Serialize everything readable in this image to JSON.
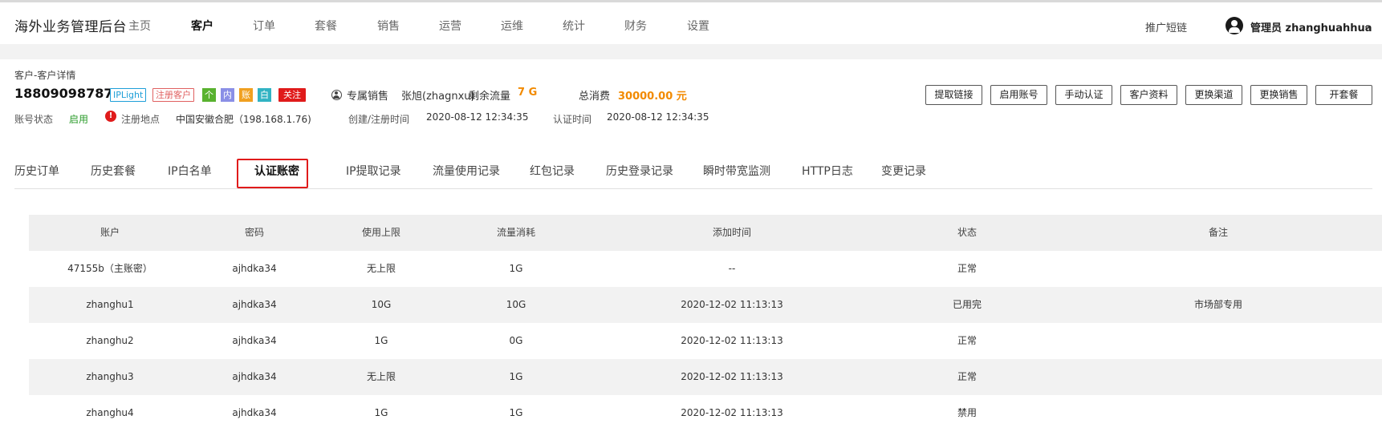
{
  "app": {
    "title": "海外业务管理后台",
    "nav": [
      "主页",
      "客户",
      "订单",
      "套餐",
      "销售",
      "运营",
      "运维",
      "统计",
      "财务",
      "设置"
    ],
    "active_nav": "客户",
    "promo_link": "推广短链",
    "user": "管理员 zhanghuahhua"
  },
  "customer": {
    "breadcrumb": "客户-客户详情",
    "phone": "18809098787",
    "tags": {
      "product": "IPLight",
      "registered": "注册客户",
      "personal": "个",
      "internal": "内",
      "account": "账",
      "white": "白",
      "follow": "关注"
    },
    "sales_label": "专属销售",
    "sales_name": "张旭(zhagnxu)",
    "remaining_label": "剩余流量",
    "remaining_value": "7 G",
    "total_label": "总消费",
    "total_value": "30000.00 元",
    "status_label": "账号状态",
    "status_value": "启用",
    "reg_place_label": "注册地点",
    "reg_place_value": "中国安徽合肥（198.168.1.76)",
    "created_label": "创建/注册时间",
    "created_value": "2020-08-12 12:34:35",
    "auth_label": "认证时间",
    "auth_value": "2020-08-12 12:34:35"
  },
  "actions": [
    "提取链接",
    "启用账号",
    "手动认证",
    "客户资料",
    "更换渠道",
    "更换销售",
    "开套餐"
  ],
  "tabs": [
    "历史订单",
    "历史套餐",
    "IP白名单",
    "认证账密",
    "IP提取记录",
    "流量使用记录",
    "红包记录",
    "历史登录记录",
    "瞬时带宽监测",
    "HTTP日志",
    "变更记录"
  ],
  "active_tab": "认证账密",
  "table": {
    "columns": [
      "账户",
      "密码",
      "使用上限",
      "流量消耗",
      "添加时间",
      "状态",
      "备注"
    ],
    "rows": [
      [
        "47155b（主账密）",
        "ajhdka34",
        "无上限",
        "1G",
        "--",
        "正常",
        ""
      ],
      [
        "zhanghu1",
        "ajhdka34",
        "10G",
        "10G",
        "2020-12-02 11:13:13",
        "已用完",
        "市场部专用"
      ],
      [
        "zhanghu2",
        "ajhdka34",
        "1G",
        "0G",
        "2020-12-02 11:13:13",
        "正常",
        ""
      ],
      [
        "zhanghu3",
        "ajhdka34",
        "无上限",
        "1G",
        "2020-12-02 11:13:13",
        "正常",
        ""
      ],
      [
        "zhanghu4",
        "ajhdka34",
        "1G",
        "1G",
        "2020-12-02 11:13:13",
        "禁用",
        ""
      ]
    ]
  },
  "colors": {
    "accent_orange": "#f28a00",
    "status_green": "#2a9b2a",
    "highlight_red": "#e01b1b",
    "tag_blue": "#1e9fd8"
  }
}
